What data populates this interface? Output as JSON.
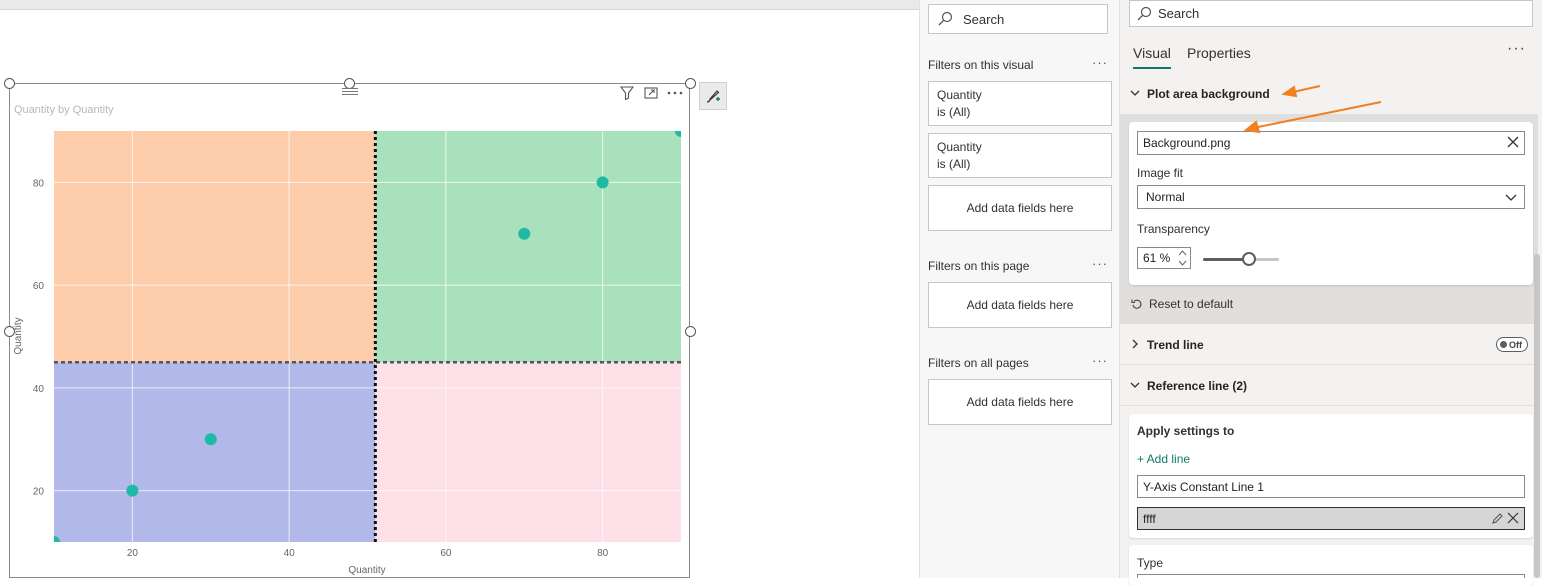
{
  "visual": {
    "title": "Quantity by Quantity",
    "x_axis_label": "Quantity",
    "y_axis_label": "Quantity"
  },
  "chart_data": {
    "type": "scatter",
    "title": "Quantity by Quantity",
    "xlabel": "Quantity",
    "ylabel": "Quantity",
    "xlim": [
      10,
      90
    ],
    "ylim": [
      10,
      90
    ],
    "x_ticks": [
      20,
      40,
      60,
      80
    ],
    "y_ticks": [
      20,
      40,
      60,
      80
    ],
    "grid": true,
    "reference_lines": {
      "x": 51,
      "y": 45
    },
    "quadrant_colors": {
      "top_left": "#fdccaa",
      "top_right": "#aae1bd",
      "bottom_left": "#b2b8e8",
      "bottom_right": "#fde0e8"
    },
    "marker_color": "#1fbaa6",
    "points": [
      {
        "x": 10,
        "y": 10
      },
      {
        "x": 20,
        "y": 20
      },
      {
        "x": 30,
        "y": 30
      },
      {
        "x": 70,
        "y": 70
      },
      {
        "x": 80,
        "y": 80
      },
      {
        "x": 90,
        "y": 90
      }
    ]
  },
  "filters": {
    "search_placeholder": "Search",
    "on_visual_label": "Filters on this visual",
    "visual_filters": [
      {
        "field": "Quantity",
        "state": "is (All)"
      },
      {
        "field": "Quantity",
        "state": "is (All)"
      }
    ],
    "add_fields_label": "Add data fields here",
    "on_page_label": "Filters on this page",
    "on_all_pages_label": "Filters on all pages"
  },
  "format": {
    "search_placeholder": "Search",
    "tabs": [
      "Visual",
      "Properties"
    ],
    "plot_area": {
      "header": "Plot area background",
      "image_file": "Background.png",
      "image_fit_label": "Image fit",
      "image_fit_value": "Normal",
      "transparency_label": "Transparency",
      "transparency_value": "61 %",
      "transparency_level": 61,
      "reset_label": "Reset to default"
    },
    "trend_line": {
      "header": "Trend line",
      "toggle": "Off"
    },
    "reference_line": {
      "header": "Reference line (2)",
      "apply_label": "Apply settings to",
      "add_line": "+ Add line",
      "selected_line": "Y-Axis Constant Line 1",
      "name_value": "ffff",
      "type_label": "Type"
    },
    "accent_color": "#117865",
    "annotation_arrow_color": "#f08020"
  }
}
